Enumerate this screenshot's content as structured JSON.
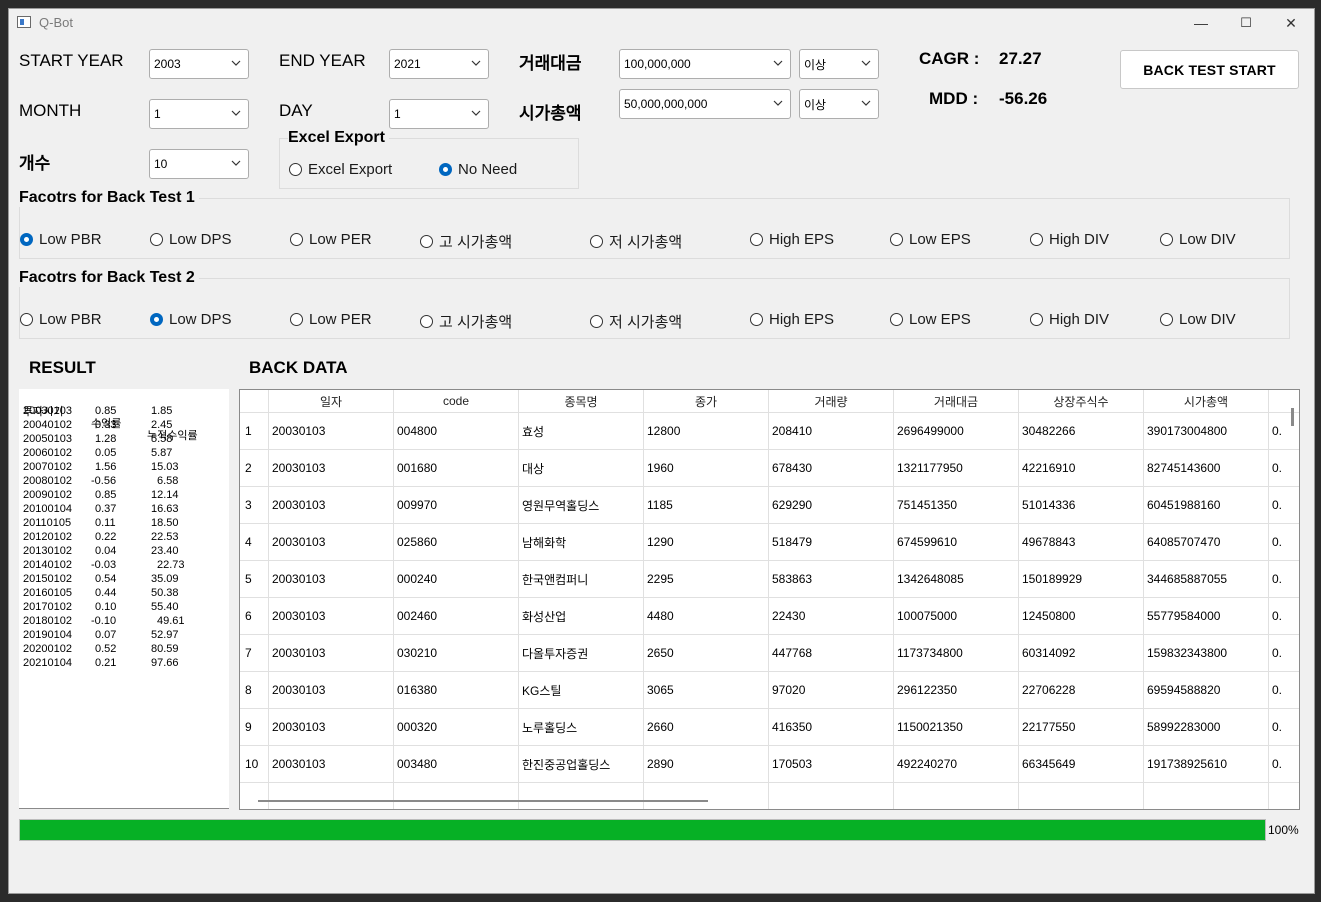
{
  "window": {
    "title": "Q-Bot",
    "min": "—",
    "max": "☐",
    "close": "✕"
  },
  "form": {
    "start_year_label": "START YEAR",
    "start_year_value": "2003",
    "end_year_label": "END YEAR",
    "end_year_value": "2021",
    "month_label": "MONTH",
    "month_value": "1",
    "day_label": "DAY",
    "day_value": "1",
    "count_label": "개수",
    "count_value": "10",
    "volume_label": "거래대금",
    "volume_value": "100,000,000",
    "volume_op": "이상",
    "marketcap_label": "시가총액",
    "marketcap_value": "50,000,000,000",
    "marketcap_op": "이상"
  },
  "stats": {
    "cagr_label": "CAGR :",
    "cagr_value": "27.27",
    "mdd_label": "MDD :",
    "mdd_value": "-56.26"
  },
  "start_button": "BACK TEST START",
  "excel": {
    "title": "Excel Export",
    "options": [
      "Excel Export",
      "No Need"
    ],
    "selected": 1
  },
  "factors1": {
    "title": "Facotrs for Back Test 1",
    "selected": 0
  },
  "factors2": {
    "title": "Facotrs for Back Test 2",
    "selected": 1
  },
  "factor_options": [
    "Low PBR",
    "Low DPS",
    "Low PER",
    "고 시가총액",
    "저 시가총액",
    "High EPS",
    "Low EPS",
    "High DIV",
    "Low DIV"
  ],
  "result": {
    "title": "RESULT",
    "headers": [
      "투자시기",
      "수익률",
      "누적수익률"
    ],
    "rows": [
      [
        "20030103",
        "0.85",
        "1.85"
      ],
      [
        "20040102",
        "0.33",
        "2.45"
      ],
      [
        "20050103",
        "1.28",
        "5.58"
      ],
      [
        "20060102",
        "0.05",
        "5.87"
      ],
      [
        "20070102",
        "1.56",
        "15.03"
      ],
      [
        "20080102",
        "-0.56",
        "6.58"
      ],
      [
        "20090102",
        "0.85",
        "12.14"
      ],
      [
        "20100104",
        "0.37",
        "16.63"
      ],
      [
        "20110105",
        "0.11",
        "18.50"
      ],
      [
        "20120102",
        "0.22",
        "22.53"
      ],
      [
        "20130102",
        "0.04",
        "23.40"
      ],
      [
        "20140102",
        "-0.03",
        "22.73"
      ],
      [
        "20150102",
        "0.54",
        "35.09"
      ],
      [
        "20160105",
        "0.44",
        "50.38"
      ],
      [
        "20170102",
        "0.10",
        "55.40"
      ],
      [
        "20180102",
        "-0.10",
        "49.61"
      ],
      [
        "20190104",
        "0.07",
        "52.97"
      ],
      [
        "20200102",
        "0.52",
        "80.59"
      ],
      [
        "20210104",
        "0.21",
        "97.66"
      ]
    ]
  },
  "back_data": {
    "title": "BACK DATA",
    "columns": [
      "일자",
      "code",
      "종목명",
      "종가",
      "거래량",
      "거래대금",
      "상장주식수",
      "시가총액",
      "0."
    ],
    "rows": [
      [
        "1",
        "20030103",
        "004800",
        "효성",
        "12800",
        "208410",
        "2696499000",
        "30482266",
        "390173004800",
        "0."
      ],
      [
        "2",
        "20030103",
        "001680",
        "대상",
        "1960",
        "678430",
        "1321177950",
        "42216910",
        "82745143600",
        "0."
      ],
      [
        "3",
        "20030103",
        "009970",
        "영원무역홀딩스",
        "1185",
        "629290",
        "751451350",
        "51014336",
        "60451988160",
        "0."
      ],
      [
        "4",
        "20030103",
        "025860",
        "남해화학",
        "1290",
        "518479",
        "674599610",
        "49678843",
        "64085707470",
        "0."
      ],
      [
        "5",
        "20030103",
        "000240",
        "한국앤컴퍼니",
        "2295",
        "583863",
        "1342648085",
        "150189929",
        "344685887055",
        "0."
      ],
      [
        "6",
        "20030103",
        "002460",
        "화성산업",
        "4480",
        "22430",
        "100075000",
        "12450800",
        "55779584000",
        "0."
      ],
      [
        "7",
        "20030103",
        "030210",
        "다올투자증권",
        "2650",
        "447768",
        "1173734800",
        "60314092",
        "159832343800",
        "0."
      ],
      [
        "8",
        "20030103",
        "016380",
        "KG스틸",
        "3065",
        "97020",
        "296122350",
        "22706228",
        "69594588820",
        "0."
      ],
      [
        "9",
        "20030103",
        "000320",
        "노루홀딩스",
        "2660",
        "416350",
        "1150021350",
        "22177550",
        "58992283000",
        "0."
      ],
      [
        "10",
        "20030103",
        "003480",
        "한진중공업홀딩스",
        "2890",
        "170503",
        "492240270",
        "66345649",
        "191738925610",
        "0."
      ]
    ]
  },
  "progress": {
    "value": 1.0,
    "label": "100%",
    "color": "#06b025"
  }
}
